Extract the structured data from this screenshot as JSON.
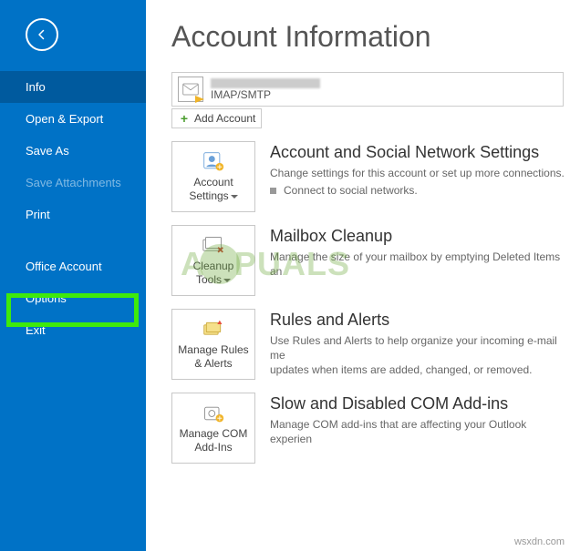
{
  "sidebar": {
    "items": [
      {
        "label": "Info",
        "selected": true
      },
      {
        "label": "Open & Export"
      },
      {
        "label": "Save As"
      },
      {
        "label": "Save Attachments",
        "disabled": true
      },
      {
        "label": "Print"
      }
    ],
    "items2": [
      {
        "label": "Office Account"
      },
      {
        "label": "Options"
      },
      {
        "label": "Exit"
      }
    ]
  },
  "page_title": "Account Information",
  "account": {
    "type": "IMAP/SMTP",
    "add_label": "Add Account"
  },
  "sections": {
    "social": {
      "tile_l1": "Account",
      "tile_l2": "Settings",
      "title": "Account and Social Network Settings",
      "desc": "Change settings for this account or set up more connections.",
      "bullet": "Connect to social networks."
    },
    "cleanup": {
      "tile_l1": "Cleanup",
      "tile_l2": "Tools",
      "title": "Mailbox Cleanup",
      "desc": "Manage the size of your mailbox by emptying Deleted Items an"
    },
    "rules": {
      "tile_l1": "Manage Rules",
      "tile_l2": "& Alerts",
      "title": "Rules and Alerts",
      "desc": "Use Rules and Alerts to help organize your incoming e-mail me",
      "desc2": "updates when items are added, changed, or removed."
    },
    "com": {
      "tile_l1": "Manage COM",
      "tile_l2": "Add-Ins",
      "title": "Slow and Disabled COM Add-ins",
      "desc": "Manage COM add-ins that are affecting your Outlook experien"
    }
  },
  "watermark": {
    "pre": "A",
    "post": "PUALS"
  },
  "attribution": "wsxdn.com"
}
